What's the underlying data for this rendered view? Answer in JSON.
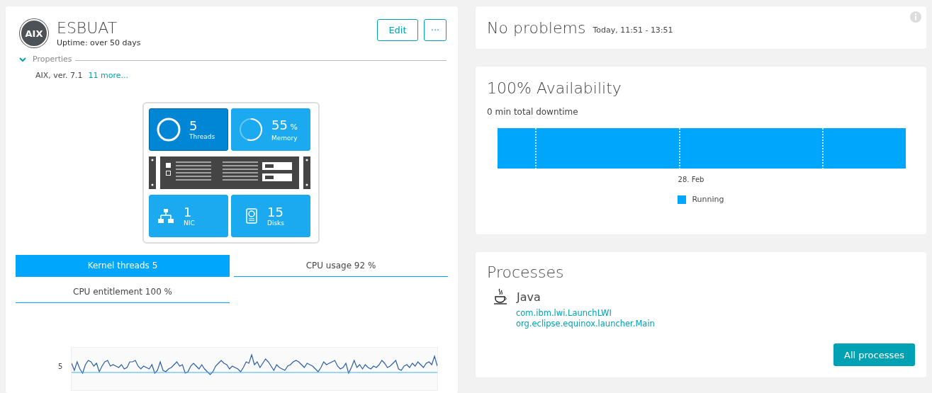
{
  "host": {
    "logo": "AIX",
    "name": "ESBUAT",
    "uptime": "Uptime: over 50 days",
    "buttons": [
      {
        "kind": "edit",
        "label": "Edit"
      },
      {
        "kind": "more",
        "label": "···"
      }
    ]
  },
  "properties": {
    "title": "Properties",
    "expanded": true,
    "summary": "AIX, ver. 7.1",
    "more_link": "11 more..."
  },
  "tiles": [
    {
      "kind": "threads",
      "value": "5",
      "label": "Threads",
      "selected": true
    },
    {
      "kind": "memory",
      "value": "55",
      "unit": "%",
      "label": "Memory",
      "level": 0.55,
      "selected": false
    },
    {
      "kind": "nic",
      "value": "1",
      "label": "NIC",
      "selected": false
    },
    {
      "kind": "disks",
      "value": "15",
      "label": "Disks",
      "selected": false
    }
  ],
  "metric_tabs": [
    {
      "label": "Kernel threads 5",
      "selected": true
    },
    {
      "label": "CPU usage 92 %",
      "selected": false
    },
    {
      "label": "CPU entitlement 100 %",
      "selected": false
    }
  ],
  "thread_chart": {
    "y_label": "5"
  },
  "problems": {
    "title": "No problems",
    "timeframe": "Today, 11:51 - 13:51"
  },
  "availability": {
    "title": "100% Availability",
    "downtime": "0 min total downtime",
    "date_label": "28. Feb",
    "legend": [
      {
        "label": "Running",
        "color": "#00a6fb"
      }
    ]
  },
  "processes": {
    "title": "Processes",
    "groups": [
      {
        "name": "Java",
        "items": [
          "com.ibm.lwi.LaunchLWI",
          "org.eclipse.equinox.launcher.Main"
        ]
      }
    ],
    "button": "All processes"
  }
}
